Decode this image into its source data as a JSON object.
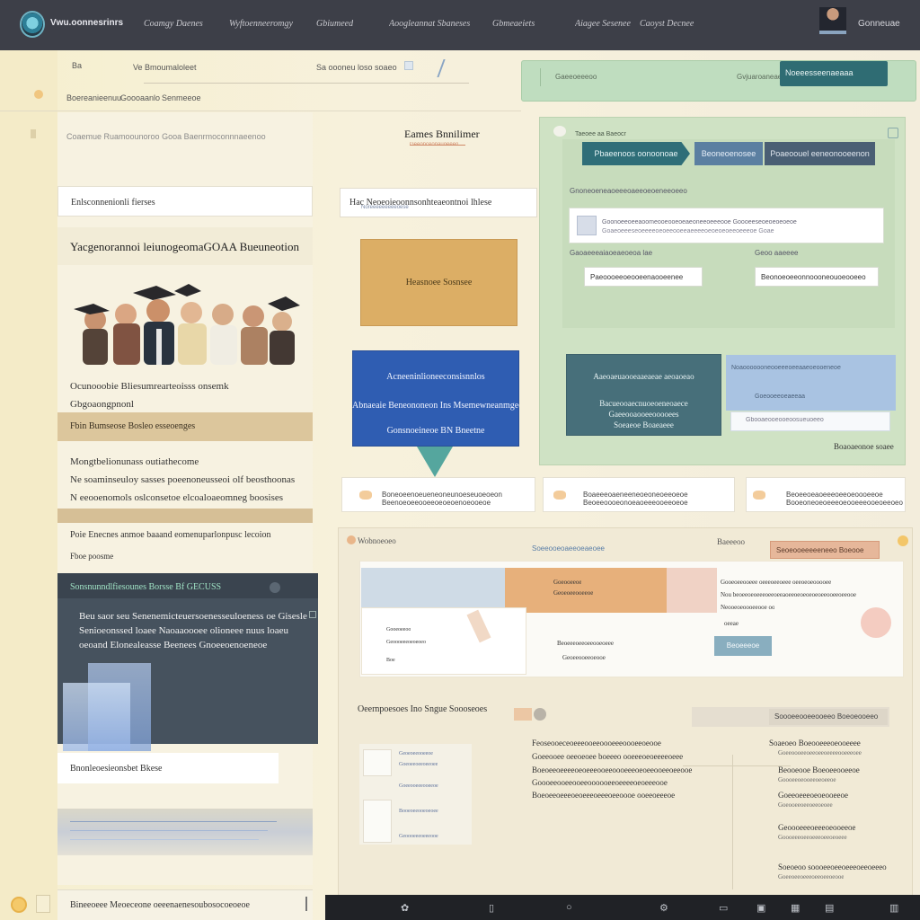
{
  "nav": {
    "brand": "Vwu.oonnesrinrs",
    "items": [
      "Coamgy Daenes",
      "Wyftoenneeromgy",
      "Gbiumeed",
      "Aoogleannat Sbaneses",
      "Gbmeaeiets",
      "Aiagee Sesenee",
      "Caoyst Decnee"
    ],
    "user": "Gonneuae"
  },
  "breadcrumb": {
    "a": "Ba",
    "b": "Ve Bmoumaloleet",
    "c": "Sa oooneu loso soaeo",
    "d": "Boereanieenuu",
    "e": "Goooaanlo",
    "f": "Senmeeoe",
    "g": "Coaemue  Ruamoounoroo  Gooa  Baenrmoconnnaeenoo"
  },
  "banner": {
    "placeholder": "Gaeeoeeeoo",
    "hint": "Gvjuaroaneae",
    "button": "Noeeesseenaeaaa"
  },
  "left": {
    "head1": "Enlsconnenionli fierses",
    "head2": "Yacgenorannoi leiunogeomaGOAA Bueuneotion",
    "caption1": "Ocunooobie Bliesumrearteoisss onsemk",
    "caption2": "Gbgoaongpnonl",
    "bar1": "Fbin  Bumseose  Bosleo  esseoenges",
    "text1": "Mongtbelionunass outiathecome",
    "text2": "Ne soaminseuloy sasses  poeenoneusseoi  olf  beosthoonas",
    "text3": "N  eeooenomols  oslconsetoe elcoaloaeomneg  boosises",
    "text4": "Poie  Enecnes  anmoe baaand  eomenuparlonpusc lecoion",
    "text5": "Fboe  poosme",
    "dark_head": "Sonsnunndlfiesounes Borsse Bf  GECUSS",
    "dark1": "Beu saor seu Senenemicteuersoenesseuloeness oe Gisesle",
    "dark2": "Senioeonssed loaee Naoaaoooee  olioneee  nuus loaeu",
    "dark3": "oeoand  Elonealeasse  Beenees  Gnoeeoenoeneoe",
    "input": "Bnonleoesieonsbet Bkese",
    "footer": "Bineeoeee  Meoeceone oeeenaenesoubosocoeoeoe"
  },
  "middle": {
    "title": "Eames Bnnilimer",
    "subtitle": "Geeonceonauoeeeo",
    "input": "Hac Neoeoieoonnsonhteaeontnoi lhlese",
    "input_sub": "Noreeeeeeeeeoese",
    "orange": "Heasnoee  Sosnsee",
    "blue1": "Acneeninlioneeconsisnnlos",
    "blue2": "Abnaeaie Beneononeon  Ins  Msemewneanmgee",
    "blue3": "Gonsnoeineoe BN Bneetne"
  },
  "right": {
    "title": "Taeoee  aa  Baeocr",
    "tab1": "Pbaeenoos oonoonoae",
    "tab2": "Beoneoenosee",
    "tab3": "Poaeoouel eeneonooeenon",
    "label1": "Gnoneoeneaoeeeoaeeoeoeneeoeeo",
    "field": "Goonoeeoeeaoomeooeooeoeaeoneeoeeeooe   Goooeeseoeoeoeoeoe",
    "field_sub": "Goaeoeeeseoeeeeoeoeeooeeaeeeeoeoeoeoeeoeeeoe  Goae",
    "label2": "Gaoaeeeaiaoeaeoeoa  lae",
    "label3": "Geoo  aaeeee",
    "in1": "Paeoooeeoeooeenaooeenee",
    "in2": "Beonoeoeeonnoooneouoeooeeo",
    "teal1": "Aaeoaeuaooeaaeaeae  aeoaoeao",
    "teal2": "Bacueooaecnuoeoeneoaece",
    "teal3": "Gaeeooaooeeooooees",
    "teal4": "Soeaeoe  Boaeaeee",
    "lblue1": "Noaooooooneooeeeoeeaaeoeooeneoe",
    "lblue2": "Goeooeeoeaeeaa",
    "lblue3": "Gbooaeooeooeoosueuoeeo",
    "footer": "Boaoaeonoe  soaee"
  },
  "pills": [
    {
      "line1": "Boneoeenoeueneoneunoeseuoeoeon",
      "line2": "Beenoeoeeooeeoeoeoenoeooeoe"
    },
    {
      "line1": "Boaeeeoaeneeneoeoneoeeoeoe",
      "line2": "Beoeeoooeonoeaoeeeooeeoeoe"
    },
    {
      "line1": "Beoeeoeaoeeeoeeoeoooeeoe",
      "line2": "Booeoneoeoeeeoeooeeeooeoeeoeo"
    }
  ],
  "bottom": {
    "title": "Wobnoeoeo",
    "link": "Soeeooeoaeeoeaeoee",
    "right_label": "Baeeeoo",
    "orange_btn": "Seoeooeeeeeneeo  Boeooe",
    "strip1": "Goeooeeoe",
    "strip2": "Geoeoeeooeeoe",
    "card1": "Gooeoeeooeee  oeeeoeeoeee  oeeoeoeooooee",
    "card2": "Nou  beoeeoeoeeeoeeoeeaoeeoeoeoeoeoeeooeeoeeooe",
    "card3": "Neooeoeoooeeooe  oo",
    "card4": "oeeae",
    "inner1": "Gooeoeeoo",
    "inner2": "Geoooeeeoeoeoeo",
    "inner3": "Boe",
    "mid1": "Beoeeeoeeoeeooeoeee",
    "mid2": "Geoeeooeeoeooe",
    "button": "Beoeeeoe",
    "section": "Oeernpoesoes  Ino  Sngue  Soooseoes",
    "para1": "Feoseooeceoeeeooeeoooeeeoooeeoeooe",
    "para2": "Goeeooee  oeeoeoee  boeeeo  ooeeeoeoeeeeoeee",
    "para3": "Boeoeeoeeeeoeoeeeooeeoooeeeoeoeeooeeoeeooe",
    "para4": "Goooeeooeeooeeoooooeeoeeeeoeoeeeooe",
    "para5": "Boeoeeoeeeoeoeeeoeeeoeeoooe  ooeeoeeeoe",
    "gray": "Soooeeooeeooeeo  Boeoeooeeo",
    "list1": "Soaeoeo  Boeooeeeoeooeeee",
    "list1b": "Goeeoooeeoeeoeeoeeeeooeeeoee",
    "list2": "Beooeooe  Boeoeeooeeoe",
    "list2b": "Goooeeoeooeeoeoeeoe",
    "list3": "Goeeoeeeoeoeooeeoe",
    "list3b": "Goeooeeoeeoeeoeoee",
    "list4": "Geoooeeeoeeeoeooeeoe",
    "list4b": "Goooeeeoeeoeeeoeeoeoeee",
    "list5": "Soeoeoo  soooeeoeeoeeeoeeoeeeo",
    "list5b": "Goeeoeeoeeeoeeoeeoeooe",
    "thumb1": "Geoeoeeooeeoe",
    "thumb2": "Goeoeeoeeoeeoee",
    "thumb3": "Goeeooeeeooeeoe",
    "thumb4": "Booeoeeooeoeoee",
    "thumb5": "Geoooeeeoeeeooe"
  },
  "taskbar": {
    "items": [
      "✿",
      "▯",
      "○",
      "⚙",
      "▭",
      "▣",
      "▦",
      "▤",
      "▥"
    ]
  }
}
